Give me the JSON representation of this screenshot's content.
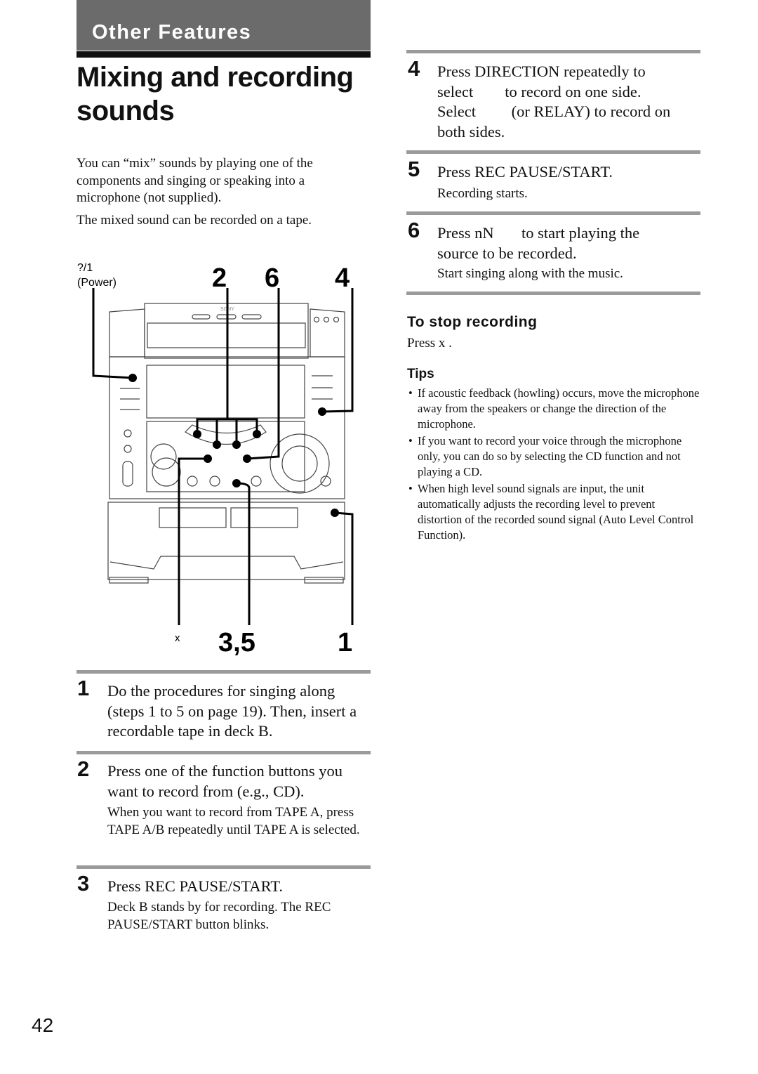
{
  "header": {
    "section": "Other Features"
  },
  "title": "Mixing and recording sounds",
  "intro": [
    "You can “mix” sounds by playing one of the components and singing or speaking into a microphone (not supplied).",
    "The mixed sound can be recorded on a tape."
  ],
  "diagram": {
    "power_symbol": "?/1",
    "power_label": "(Power)",
    "callouts": {
      "two": "2",
      "six": "6",
      "four": "4",
      "stop": "x",
      "three_five": "3,5",
      "one": "1"
    },
    "brand": "SONY"
  },
  "steps": [
    {
      "num": "1",
      "text": "Do the procedures for singing along (steps 1 to 5 on page 19). Then, insert a recordable tape in deck B.",
      "note": ""
    },
    {
      "num": "2",
      "text": "Press one of the function buttons you want to record from (e.g., CD).",
      "note": "When you want to record from TAPE A, press TAPE A/B repeatedly until TAPE A is selected."
    },
    {
      "num": "3",
      "text": "Press REC PAUSE/START.",
      "note": "Deck B stands by for recording. The REC PAUSE/START button blinks."
    },
    {
      "num": "4",
      "lines": [
        "Press DIRECTION repeatedly to",
        "select        to record on one side.",
        "Select         (or RELAY) to record on",
        "both sides."
      ],
      "note": ""
    },
    {
      "num": "5",
      "text": "Press REC PAUSE/START.",
      "note": "Recording starts."
    },
    {
      "num": "6",
      "lines": [
        "Press nN       to start playing the",
        "source to be recorded."
      ],
      "note": "Start singing along with the music."
    }
  ],
  "stop": {
    "heading": "To stop recording",
    "text": "Press x ."
  },
  "tips": {
    "heading": "Tips",
    "items": [
      "If acoustic feedback (howling) occurs, move the microphone away from the speakers or change the direction of the microphone.",
      "If you want to record your voice through the microphone only, you can do so by selecting the CD function and not playing a CD.",
      "When high level sound signals are input, the unit automatically adjusts the recording level to prevent distortion of the recorded sound signal (Auto Level Control Function)."
    ]
  },
  "page_number": "42",
  "colors": {
    "header_bg": "#6b6b6b",
    "rule": "#9a9a9a",
    "text": "#111111"
  }
}
